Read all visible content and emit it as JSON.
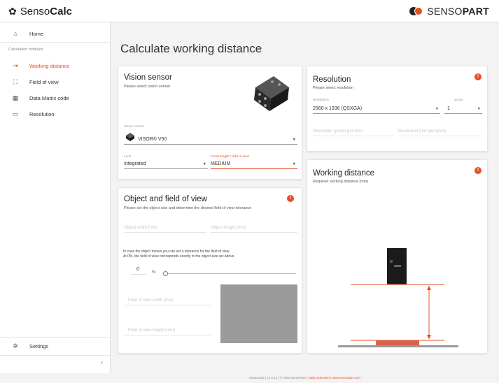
{
  "header": {
    "app_name_light": "Senso",
    "app_name_bold": "Calc",
    "brand_light": "SENSO",
    "brand_bold": "PART"
  },
  "sidebar": {
    "home": "Home",
    "section": "Calculation modules",
    "items": [
      {
        "label": "Working distance",
        "icon": "arrow-to-line-icon",
        "active": true
      },
      {
        "label": "Field of view",
        "icon": "field-of-view-icon",
        "active": false
      },
      {
        "label": "Data Matrix code",
        "icon": "data-matrix-icon",
        "active": false
      },
      {
        "label": "Resolution",
        "icon": "resolution-icon",
        "active": false
      }
    ],
    "settings": "Settings",
    "collapse": "‹"
  },
  "page": {
    "title": "Calculate working distance"
  },
  "vision_sensor": {
    "title": "Vision sensor",
    "subtitle": "Please select vision sensor",
    "sensor_label": "Vision sensor",
    "sensor_value": "VISOR® V50",
    "lens_label": "Lens",
    "lens_value": "Integrated",
    "focal_label": "Focal length / field of view",
    "focal_value": "MEDIUM"
  },
  "object_fov": {
    "title": "Object and field of view",
    "subtitle": "Please set the object size and determine the desired field of view tolerance",
    "object_width_placeholder": "Object width (mm)",
    "object_height_placeholder": "Object height (mm)",
    "note_line1": "In case the object moves you can set a tolerance for the field of view.",
    "note_line2": "At 0%, the field of view corresponds exactly to the object size set above.",
    "tolerance_value": "0",
    "tolerance_unit": "%",
    "tolerance_percent": 0,
    "fov_width_placeholder": "Field of view width (mm)",
    "fov_height_placeholder": "Field of view height (mm)"
  },
  "resolution": {
    "title": "Resolution",
    "subtitle": "Please select resolution",
    "resolution_label": "Resolution",
    "resolution_value": "2560 x 1936 (QSXGA)",
    "zoom_label": "Zoom",
    "zoom_value": "1",
    "ppm_placeholder": "Resolution (pixels per mm)",
    "mmpp_placeholder": "Resolution (mm per pixel)"
  },
  "working_distance": {
    "title": "Working distance",
    "subtitle": "Required working distance (mm)"
  },
  "footer": {
    "app": "SensoCalc",
    "version": "| v2.0.12 | © 2022 SensoPart |",
    "link_text": "Data protection | www.sensopart.com"
  },
  "colors": {
    "accent": "#e84d25",
    "background": "#f3f3f3",
    "card": "#ffffff",
    "fov_box": "#9b9b9b"
  }
}
